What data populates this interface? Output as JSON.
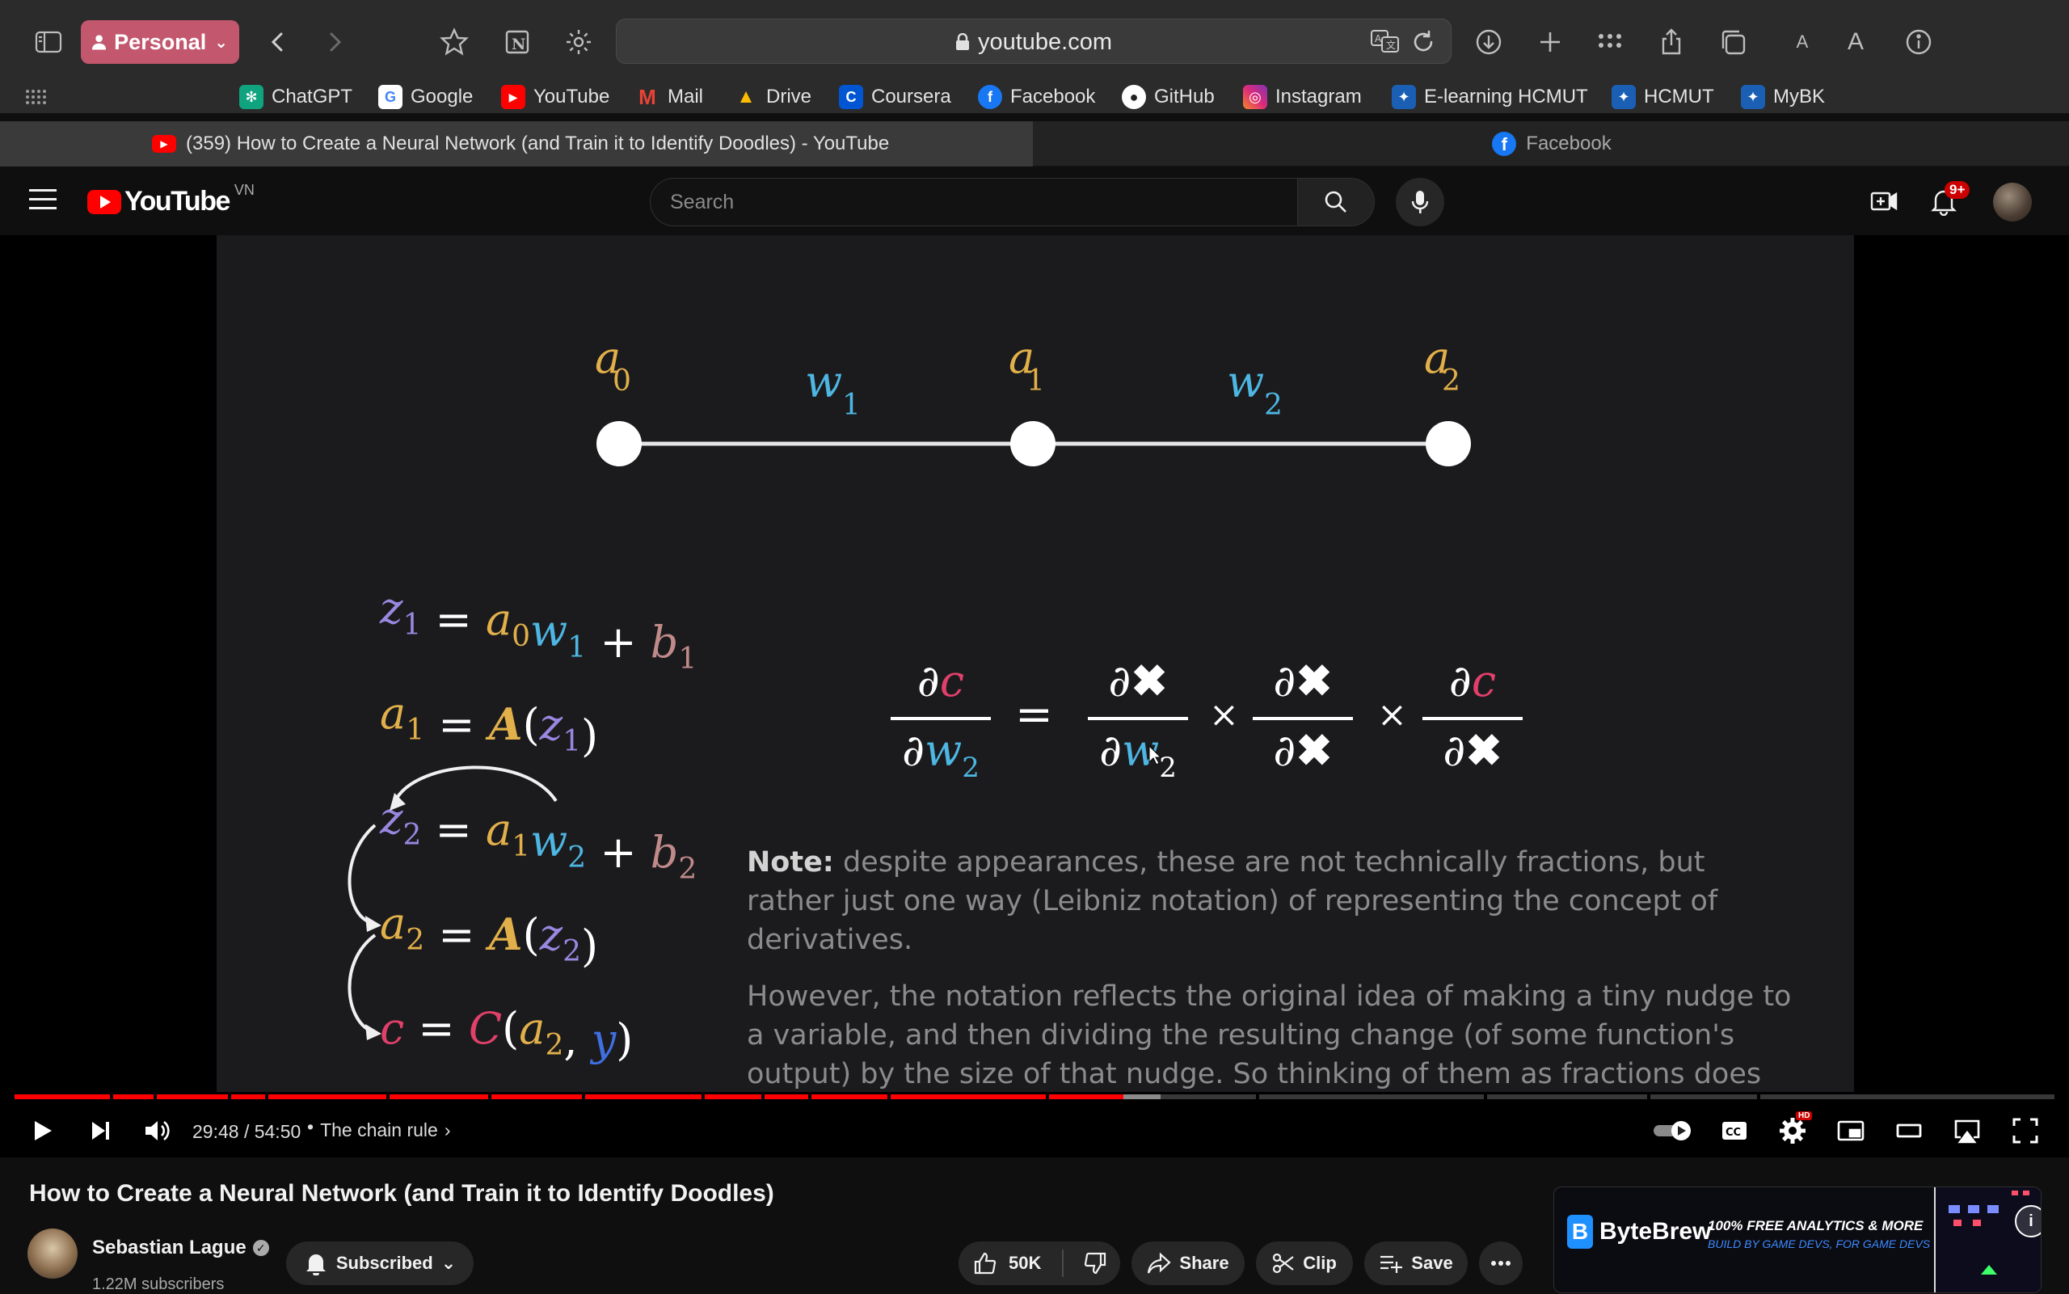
{
  "browser": {
    "profile_label": "Personal",
    "address": "youtube.com",
    "bookmarks": [
      {
        "label": "ChatGPT",
        "icon": "chatgpt-icon",
        "color": "#10a37f"
      },
      {
        "label": "Google",
        "icon": "google-icon",
        "color": "#4285f4"
      },
      {
        "label": "YouTube",
        "icon": "youtube-icon",
        "color": "#ff0000"
      },
      {
        "label": "Mail",
        "icon": "gmail-icon",
        "color": "#ea4335"
      },
      {
        "label": "Drive",
        "icon": "drive-icon",
        "color": "#fbbc04"
      },
      {
        "label": "Coursera",
        "icon": "coursera-icon",
        "color": "#0056d2"
      },
      {
        "label": "Facebook",
        "icon": "facebook-icon",
        "color": "#1877f2"
      },
      {
        "label": "GitHub",
        "icon": "github-icon",
        "color": "#ffffff"
      },
      {
        "label": "Instagram",
        "icon": "instagram-icon",
        "color": "#e1306c"
      },
      {
        "label": "E-learning HCMUT",
        "icon": "hcmut-icon",
        "color": "#1a5fb4"
      },
      {
        "label": "HCMUT",
        "icon": "hcmut-icon",
        "color": "#1a5fb4"
      },
      {
        "label": "MyBK",
        "icon": "hcmut-icon",
        "color": "#1a5fb4"
      }
    ],
    "tabs": [
      {
        "title": "(359) How to Create a Neural Network (and Train it to Identify Doodles) - YouTube",
        "icon": "youtube-icon",
        "active": true
      },
      {
        "title": "Facebook",
        "icon": "facebook-icon",
        "active": false
      }
    ]
  },
  "youtube": {
    "logo_text": "YouTube",
    "region": "VN",
    "search_placeholder": "Search",
    "notification_count": "9+"
  },
  "video": {
    "title": "How to Create a Neural Network (and Train it to Identify Doodles)",
    "current_time": "29:48",
    "duration": "54:50",
    "time_display": "29:48 / 54:50",
    "chapter": "The chain rule",
    "played_fraction": 0.5435,
    "buffered_fraction": 0.5619,
    "quality_badge": "HD",
    "slide": {
      "node_labels": [
        "a",
        "a",
        "a"
      ],
      "node_subscripts": [
        "0",
        "1",
        "2"
      ],
      "weight_labels": [
        "w",
        "w"
      ],
      "weight_subscripts": [
        "1",
        "2"
      ],
      "note_bold": "Note:",
      "note_text": " despite appearances, these are not technically fractions, but rather just one way (Leibniz notation) of representing the concept of derivatives.",
      "paragraph": "However, the notation reflects the original idea of making a tiny nudge to a variable, and then dividing the resulting change (of some function's output) by the size of that nudge. So thinking of them as fractions does make sense on an intuitive level at least.",
      "colors": {
        "a": "#e2b04a",
        "w": "#4db6e2",
        "z": "#9a87e0",
        "b": "#c08a8a",
        "c": "#e0406a",
        "A": "#e2b04a",
        "C": "#e0406a",
        "y": "#3f6fe0",
        "text": "#ffffff"
      }
    }
  },
  "channel": {
    "name": "Sebastian Lague",
    "subscribers": "1.22M subscribers",
    "subscribe_label": "Subscribed"
  },
  "actions": {
    "likes": "50K",
    "share": "Share",
    "clip": "Clip",
    "save": "Save"
  },
  "ad": {
    "brand": "ByteBrew",
    "tagline": "100% FREE ANALYTICS & MORE",
    "subtagline": "BUILD BY GAME DEVS, FOR GAME DEVS"
  }
}
